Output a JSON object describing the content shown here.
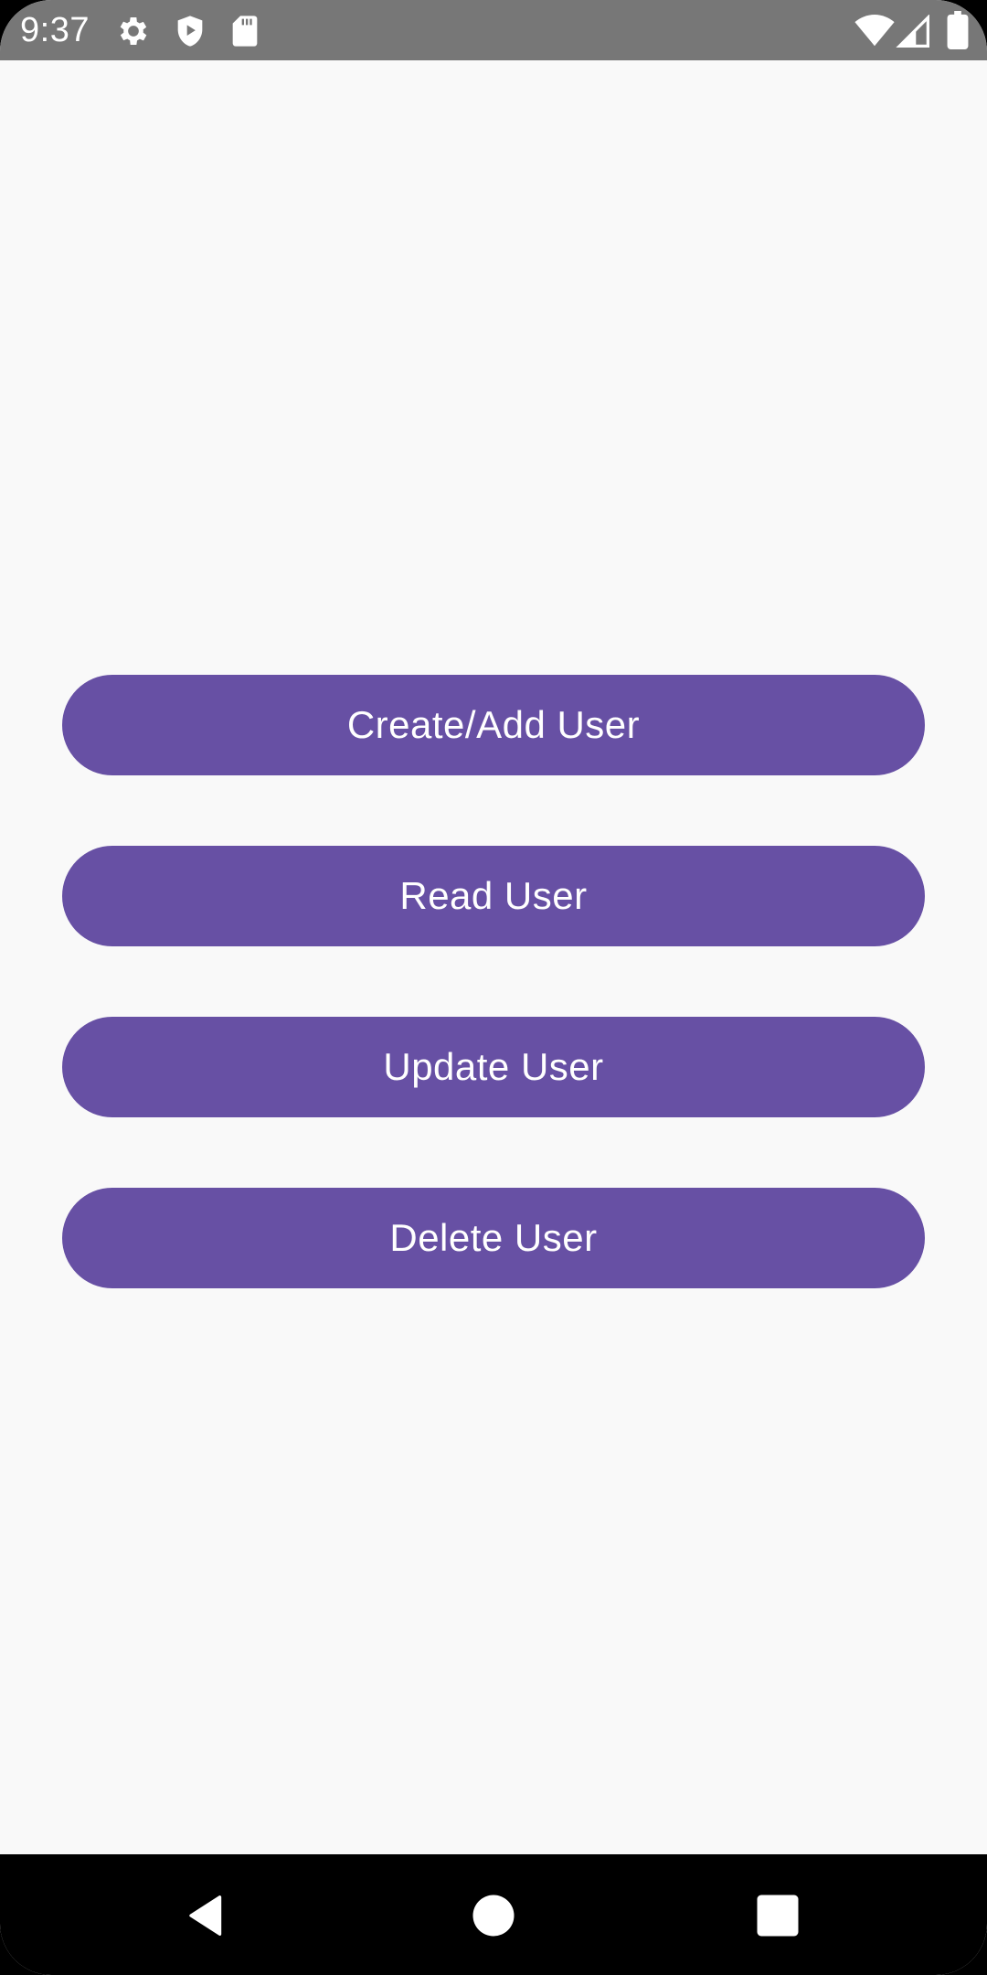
{
  "status_bar": {
    "time": "9:37",
    "icons": [
      "gear-icon",
      "shield-play-icon",
      "sd-card-icon",
      "wifi-icon",
      "signal-icon",
      "battery-icon"
    ]
  },
  "actions": {
    "buttons": [
      {
        "label": "Create/Add User"
      },
      {
        "label": "Read User"
      },
      {
        "label": "Update User"
      },
      {
        "label": "Delete User"
      }
    ]
  },
  "navigation": {
    "icons": [
      "back-icon",
      "home-icon",
      "recents-icon"
    ]
  },
  "colors": {
    "accent": "#6750a4",
    "status_bar": "#777777",
    "background": "#f9f9f9",
    "nav_bar": "#000000"
  }
}
